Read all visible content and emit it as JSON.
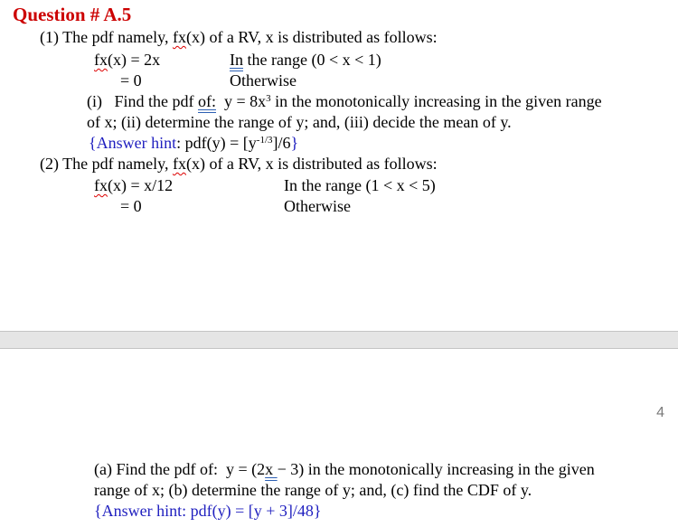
{
  "page1": {
    "title": "Question # A.5",
    "q1": {
      "intro_prefix": "(1) The pdf namely, ",
      "fx": "fx",
      "intro_suffix": "(x) of a RV, x is distributed as follows:",
      "case1_fx": "fx",
      "case1_expr": "(x) = 2x",
      "case1_range_in": "In",
      "case1_range_rest": " the range (0 < x < 1)",
      "case2_expr": "= 0",
      "case2_range": "Otherwise",
      "task_line1_a": "(i)   Find the pdf ",
      "task_line1_of": "of:",
      "task_line1_b": "  y = 8x",
      "task_line1_sup": "3",
      "task_line1_c": " in the monotonically increasing in the given range",
      "task_line2": "of x; (ii) determine the range of y; and, (iii) decide the mean of y.",
      "hint_open": "{Answer hint",
      "hint_body_a": ": pdf(y) = [y",
      "hint_sup": "-1/3",
      "hint_body_b": "]/6",
      "hint_close": "}"
    },
    "q2": {
      "intro_prefix": "(2) The pdf namely, ",
      "fx": "fx",
      "intro_suffix": "(x) of a RV, x is distributed as follows:",
      "case1_fx": "fx",
      "case1_expr": "(x) = x/12",
      "case1_range": "In the range (1 < x < 5)",
      "case2_expr": "= 0",
      "case2_range": "Otherwise"
    }
  },
  "page2": {
    "page_number": "4",
    "task_line1_a": "(a) Find the pdf of:  y = (2",
    "task_line1_x": "x ",
    "task_line1_b": "− 3) in the monotonically increasing in the given",
    "task_line2": "range of x; (b) determine the range of y; and, (c) find the CDF of y.",
    "hint": "{Answer hint: pdf(y) = [y + 3]/48}"
  }
}
